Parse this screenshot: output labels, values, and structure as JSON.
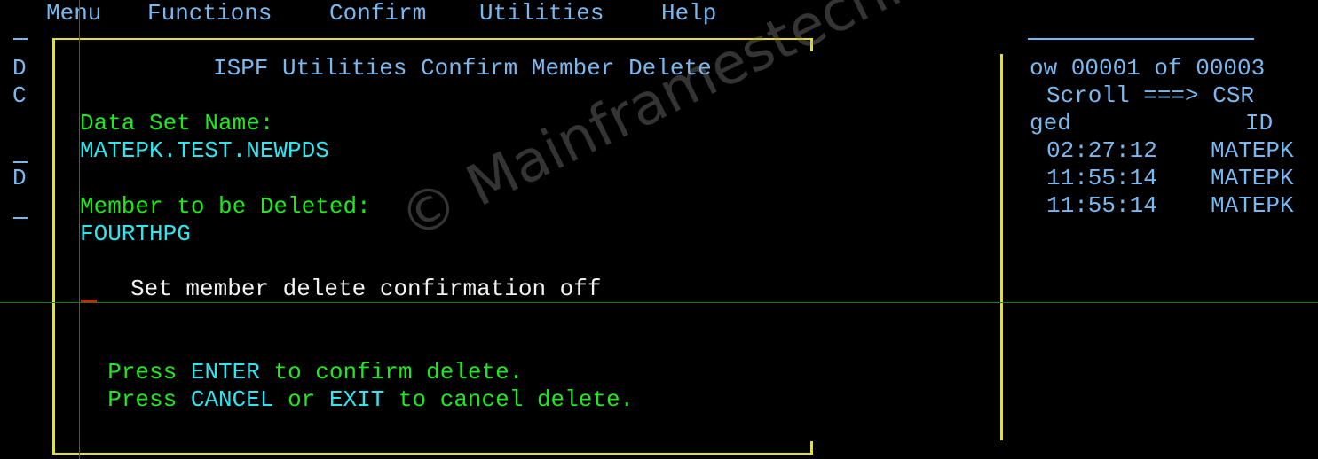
{
  "menu_bar": {
    "items": [
      {
        "label": "Menu"
      },
      {
        "label": "Functions"
      },
      {
        "label": "Confirm"
      },
      {
        "label": "Utilities"
      },
      {
        "label": "Help"
      }
    ]
  },
  "left_gutter": {
    "row1": "D",
    "row2": "C",
    "row3": "D"
  },
  "popup": {
    "title": "ISPF Utilities Confirm Member Delete",
    "data_set_label": "Data Set Name:",
    "data_set_value": "MATEPK.TEST.NEWPDS",
    "member_label": "Member to be Deleted:",
    "member_value": "FOURTHPG",
    "confirm_off_option": "Set member delete confirmation off",
    "confirm_off_input": "",
    "instruction1": {
      "pre": "Press ",
      "key": "ENTER",
      "post": " to confirm delete."
    },
    "instruction2": {
      "pre": "Press ",
      "key1": "CANCEL",
      "mid": " or ",
      "key2": "EXIT",
      "post": " to cancel delete."
    }
  },
  "right_panel": {
    "row_info": "ow 00001 of 00003",
    "scroll": "Scroll ===> CSR",
    "col_header_left": "ged",
    "col_header_right": "ID",
    "rows": [
      {
        "time": "02:27:12",
        "id": "MATEPK"
      },
      {
        "time": "11:55:14",
        "id": "MATEPK"
      },
      {
        "time": "11:55:14",
        "id": "MATEPK"
      }
    ]
  },
  "watermark": "© Mainframestechhelp",
  "colors": {
    "menu_text": "#7ab8f0",
    "label_text": "#1fe81f",
    "value_text": "#2fe6f0",
    "option_text": "#f2f2f2",
    "border": "#e8e21a",
    "cursor": "#d02010"
  }
}
